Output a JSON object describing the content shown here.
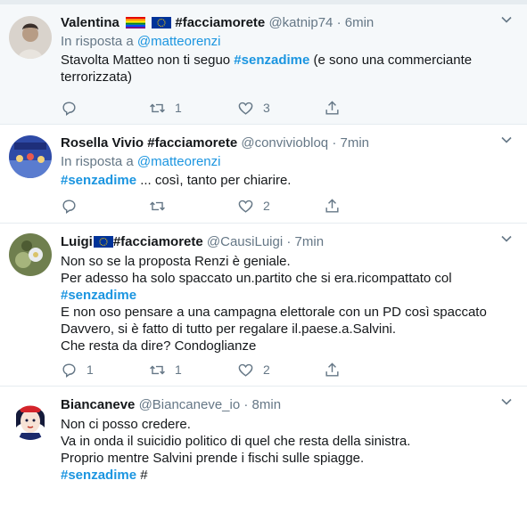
{
  "tweets": [
    {
      "name": "Valentina",
      "name_suffix": "#facciamorete",
      "handle": "@katnip74",
      "dot": "·",
      "time": "6min",
      "reply_prefix": "In risposta a",
      "reply_to": "@matteorenzi",
      "text_a": "Stavolta Matteo non ti seguo ",
      "hashtag": "#senzadime",
      "text_b": " (e sono una commerciante terrorizzata)",
      "replies": "",
      "retweets": "1",
      "likes": "3",
      "avatar_color": "#cfc8c0"
    },
    {
      "name": "Rosella Vivio",
      "name_suffix": "#facciamorete",
      "handle": "@conviviobloq",
      "dot": "·",
      "time": "7min",
      "reply_prefix": "In risposta a",
      "reply_to": "@matteorenzi",
      "hashtag": "#senzadime",
      "text_b": " ... così, tanto per chiarire.",
      "replies": "",
      "retweets": "",
      "likes": "2",
      "avatar_color": "#3a4fa0"
    },
    {
      "name": "Luigi",
      "name_suffix": "#facciamorete",
      "handle": "@CausiLuigi",
      "dot": "·",
      "time": "7min",
      "line1": "Non so se la proposta Renzi è geniale.",
      "line2": "Per adesso ha solo spaccato un.partito che si era.ricompattato col",
      "hashtag": "#senzadime",
      "line4": "E non oso pensare a una campagna elettorale con un PD così spaccato",
      "line5": "Davvero, si è fatto di tutto per regalare il.paese.a.Salvini.",
      "line6": "Che resta da dire? Condoglianze",
      "replies": "1",
      "retweets": "1",
      "likes": "2",
      "avatar_color": "#8a9a6a"
    },
    {
      "name": "Biancaneve",
      "handle": "@Biancaneve_io",
      "dot": "·",
      "time": "8min",
      "line1": "Non ci posso credere.",
      "line2": "Va in onda il suicidio politico di quel che resta della sinistra.",
      "line3": "Proprio mentre Salvini prende i fischi sulle spiagge.",
      "hashtag": "#senzadime",
      "hash_tail": " #",
      "avatar_color": "#1c2a6b"
    }
  ],
  "icons": {
    "reply": "reply-icon",
    "retweet": "retweet-icon",
    "like": "heart-icon",
    "share": "share-icon",
    "caret": "chevron-down-icon"
  },
  "colors": {
    "link": "#1b95e0",
    "muted": "#657786",
    "text": "#14171a",
    "highlight_bg": "#f5f8fa",
    "divider": "#e6ecf0"
  }
}
